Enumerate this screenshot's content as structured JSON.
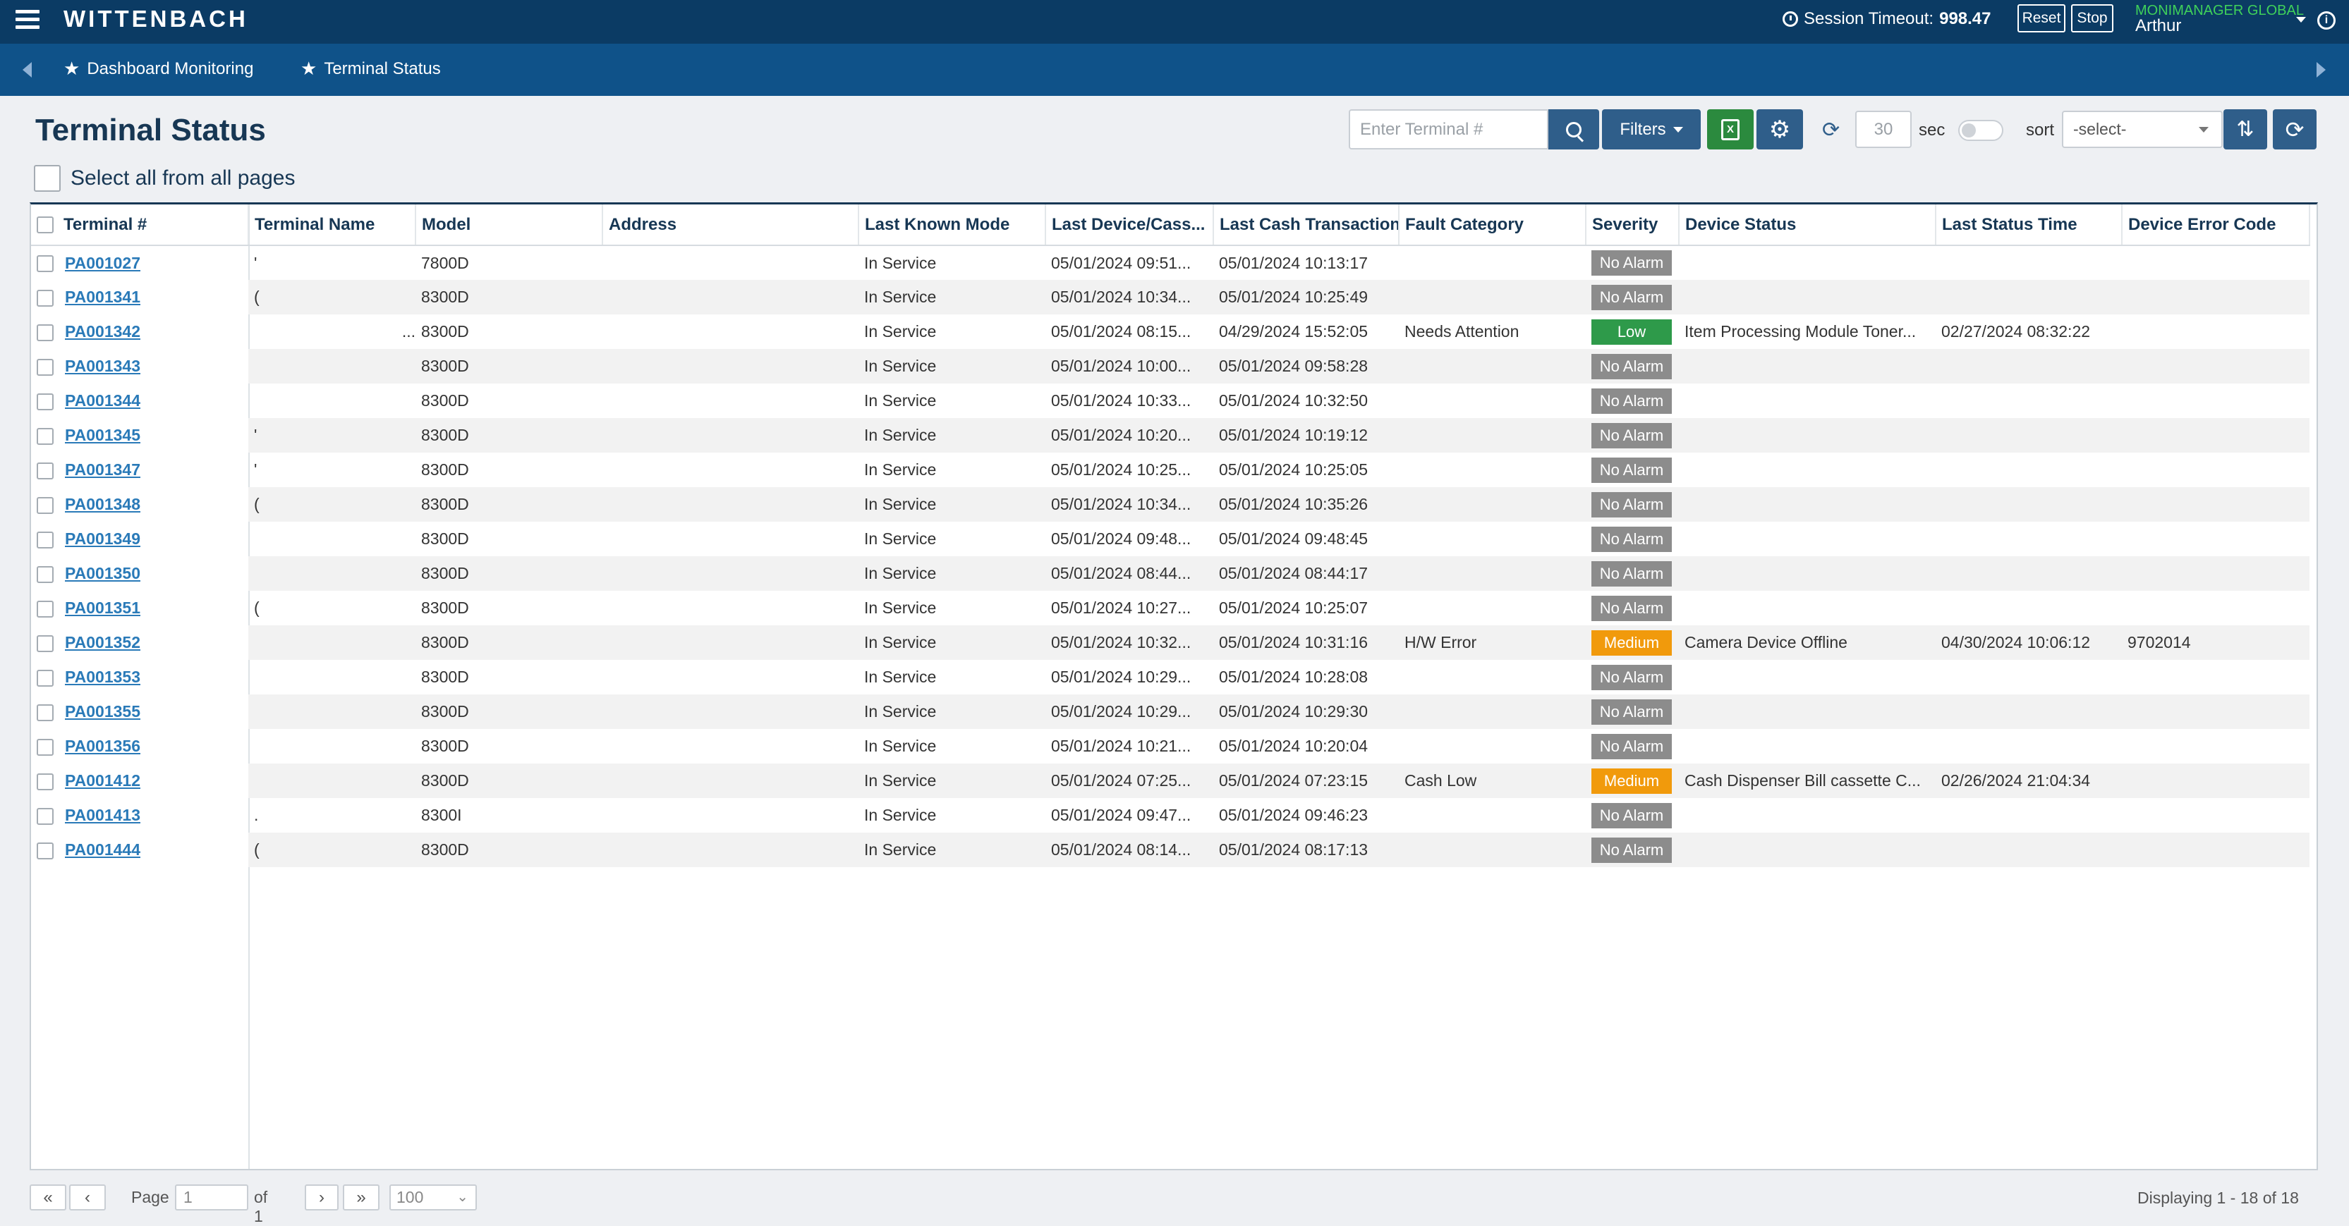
{
  "brand": "WITTENBACH",
  "session": {
    "label": "Session Timeout:",
    "value": "998.47"
  },
  "buttons": {
    "reset": "Reset",
    "stop": "Stop"
  },
  "user": {
    "org": "MONIMANAGER GLOBAL",
    "name": "Arthur"
  },
  "nav": {
    "items": [
      "Dashboard Monitoring",
      "Terminal Status"
    ]
  },
  "page": {
    "title": "Terminal Status"
  },
  "toolbar": {
    "search_placeholder": "Enter Terminal #",
    "filters_label": "Filters",
    "refresh_interval": "30",
    "sec_label": "sec",
    "sort_label": "sort",
    "sort_value": "-select-"
  },
  "select_all_label": "Select all from all pages",
  "table": {
    "columns": [
      "Terminal #",
      "Terminal Name",
      "Model",
      "Address",
      "Last Known Mode",
      "Last Device/Cass...",
      "Last Cash Transaction",
      "Fault Category",
      "Severity",
      "Device Status",
      "Last Status Time",
      "Device Error Code"
    ],
    "rows": [
      {
        "terminal": "PA001027",
        "name": "'",
        "model": "7800D",
        "address": "",
        "mode": "In Service",
        "last_device": "05/01/2024 09:51...",
        "last_cash": "05/01/2024 10:13:17",
        "fault": "",
        "severity": "No Alarm",
        "sev_class": "none",
        "device_status": "",
        "status_time": "",
        "error_code": ""
      },
      {
        "terminal": "PA001341",
        "name": "(",
        "model": "8300D",
        "address": "",
        "mode": "In Service",
        "last_device": "05/01/2024 10:34...",
        "last_cash": "05/01/2024 10:25:49",
        "fault": "",
        "severity": "No Alarm",
        "sev_class": "none",
        "device_status": "",
        "status_time": "",
        "error_code": ""
      },
      {
        "terminal": "PA001342",
        "name": "...",
        "model": "8300D",
        "address": "",
        "mode": "In Service",
        "last_device": "05/01/2024 08:15...",
        "last_cash": "04/29/2024 15:52:05",
        "fault": "Needs Attention",
        "severity": "Low",
        "sev_class": "low",
        "device_status": "Item Processing Module Toner...",
        "status_time": "02/27/2024 08:32:22",
        "error_code": ""
      },
      {
        "terminal": "PA001343",
        "name": "",
        "model": "8300D",
        "address": "",
        "mode": "In Service",
        "last_device": "05/01/2024 10:00...",
        "last_cash": "05/01/2024 09:58:28",
        "fault": "",
        "severity": "No Alarm",
        "sev_class": "none",
        "device_status": "",
        "status_time": "",
        "error_code": ""
      },
      {
        "terminal": "PA001344",
        "name": "",
        "model": "8300D",
        "address": "",
        "mode": "In Service",
        "last_device": "05/01/2024 10:33...",
        "last_cash": "05/01/2024 10:32:50",
        "fault": "",
        "severity": "No Alarm",
        "sev_class": "none",
        "device_status": "",
        "status_time": "",
        "error_code": ""
      },
      {
        "terminal": "PA001345",
        "name": "'",
        "model": "8300D",
        "address": "",
        "mode": "In Service",
        "last_device": "05/01/2024 10:20...",
        "last_cash": "05/01/2024 10:19:12",
        "fault": "",
        "severity": "No Alarm",
        "sev_class": "none",
        "device_status": "",
        "status_time": "",
        "error_code": ""
      },
      {
        "terminal": "PA001347",
        "name": "'",
        "model": "8300D",
        "address": "",
        "mode": "In Service",
        "last_device": "05/01/2024 10:25...",
        "last_cash": "05/01/2024 10:25:05",
        "fault": "",
        "severity": "No Alarm",
        "sev_class": "none",
        "device_status": "",
        "status_time": "",
        "error_code": ""
      },
      {
        "terminal": "PA001348",
        "name": "(",
        "model": "8300D",
        "address": "",
        "mode": "In Service",
        "last_device": "05/01/2024 10:34...",
        "last_cash": "05/01/2024 10:35:26",
        "fault": "",
        "severity": "No Alarm",
        "sev_class": "none",
        "device_status": "",
        "status_time": "",
        "error_code": ""
      },
      {
        "terminal": "PA001349",
        "name": "",
        "model": "8300D",
        "address": "",
        "mode": "In Service",
        "last_device": "05/01/2024 09:48...",
        "last_cash": "05/01/2024 09:48:45",
        "fault": "",
        "severity": "No Alarm",
        "sev_class": "none",
        "device_status": "",
        "status_time": "",
        "error_code": ""
      },
      {
        "terminal": "PA001350",
        "name": "",
        "model": "8300D",
        "address": "",
        "mode": "In Service",
        "last_device": "05/01/2024 08:44...",
        "last_cash": "05/01/2024 08:44:17",
        "fault": "",
        "severity": "No Alarm",
        "sev_class": "none",
        "device_status": "",
        "status_time": "",
        "error_code": ""
      },
      {
        "terminal": "PA001351",
        "name": "(",
        "model": "8300D",
        "address": "",
        "mode": "In Service",
        "last_device": "05/01/2024 10:27...",
        "last_cash": "05/01/2024 10:25:07",
        "fault": "",
        "severity": "No Alarm",
        "sev_class": "none",
        "device_status": "",
        "status_time": "",
        "error_code": ""
      },
      {
        "terminal": "PA001352",
        "name": "",
        "model": "8300D",
        "address": "",
        "mode": "In Service",
        "last_device": "05/01/2024 10:32...",
        "last_cash": "05/01/2024 10:31:16",
        "fault": "H/W Error",
        "severity": "Medium",
        "sev_class": "medium",
        "device_status": "Camera Device Offline",
        "status_time": "04/30/2024 10:06:12",
        "error_code": "9702014"
      },
      {
        "terminal": "PA001353",
        "name": "",
        "model": "8300D",
        "address": "",
        "mode": "In Service",
        "last_device": "05/01/2024 10:29...",
        "last_cash": "05/01/2024 10:28:08",
        "fault": "",
        "severity": "No Alarm",
        "sev_class": "none",
        "device_status": "",
        "status_time": "",
        "error_code": ""
      },
      {
        "terminal": "PA001355",
        "name": "",
        "model": "8300D",
        "address": "",
        "mode": "In Service",
        "last_device": "05/01/2024 10:29...",
        "last_cash": "05/01/2024 10:29:30",
        "fault": "",
        "severity": "No Alarm",
        "sev_class": "none",
        "device_status": "",
        "status_time": "",
        "error_code": ""
      },
      {
        "terminal": "PA001356",
        "name": "",
        "model": "8300D",
        "address": "",
        "mode": "In Service",
        "last_device": "05/01/2024 10:21...",
        "last_cash": "05/01/2024 10:20:04",
        "fault": "",
        "severity": "No Alarm",
        "sev_class": "none",
        "device_status": "",
        "status_time": "",
        "error_code": ""
      },
      {
        "terminal": "PA001412",
        "name": "",
        "model": "8300D",
        "address": "",
        "mode": "In Service",
        "last_device": "05/01/2024 07:25...",
        "last_cash": "05/01/2024 07:23:15",
        "fault": "Cash Low",
        "severity": "Medium",
        "sev_class": "medium",
        "device_status": "Cash Dispenser Bill cassette C...",
        "status_time": "02/26/2024 21:04:34",
        "error_code": ""
      },
      {
        "terminal": "PA001413",
        "name": ".",
        "model": "8300I",
        "address": "",
        "mode": "In Service",
        "last_device": "05/01/2024 09:47...",
        "last_cash": "05/01/2024 09:46:23",
        "fault": "",
        "severity": "No Alarm",
        "sev_class": "none",
        "device_status": "",
        "status_time": "",
        "error_code": ""
      },
      {
        "terminal": "PA001444",
        "name": "(",
        "model": "8300D",
        "address": "",
        "mode": "In Service",
        "last_device": "05/01/2024 08:14...",
        "last_cash": "05/01/2024 08:17:13",
        "fault": "",
        "severity": "No Alarm",
        "sev_class": "none",
        "device_status": "",
        "status_time": "",
        "error_code": ""
      }
    ]
  },
  "pager": {
    "first": "«",
    "prev": "‹",
    "next": "›",
    "last": "»",
    "page_label": "Page",
    "page_value": "1",
    "of_label": "of 1",
    "page_size": "100",
    "display_info": "Displaying 1 - 18 of 18"
  },
  "colors": {
    "topbar": "#0b3b64",
    "navbar": "#0f5289",
    "accent": "#2f5e8a",
    "link": "#2a7ab8",
    "low": "#2e9a4a",
    "medium": "#f19a0c",
    "none": "#8c8c8c"
  }
}
